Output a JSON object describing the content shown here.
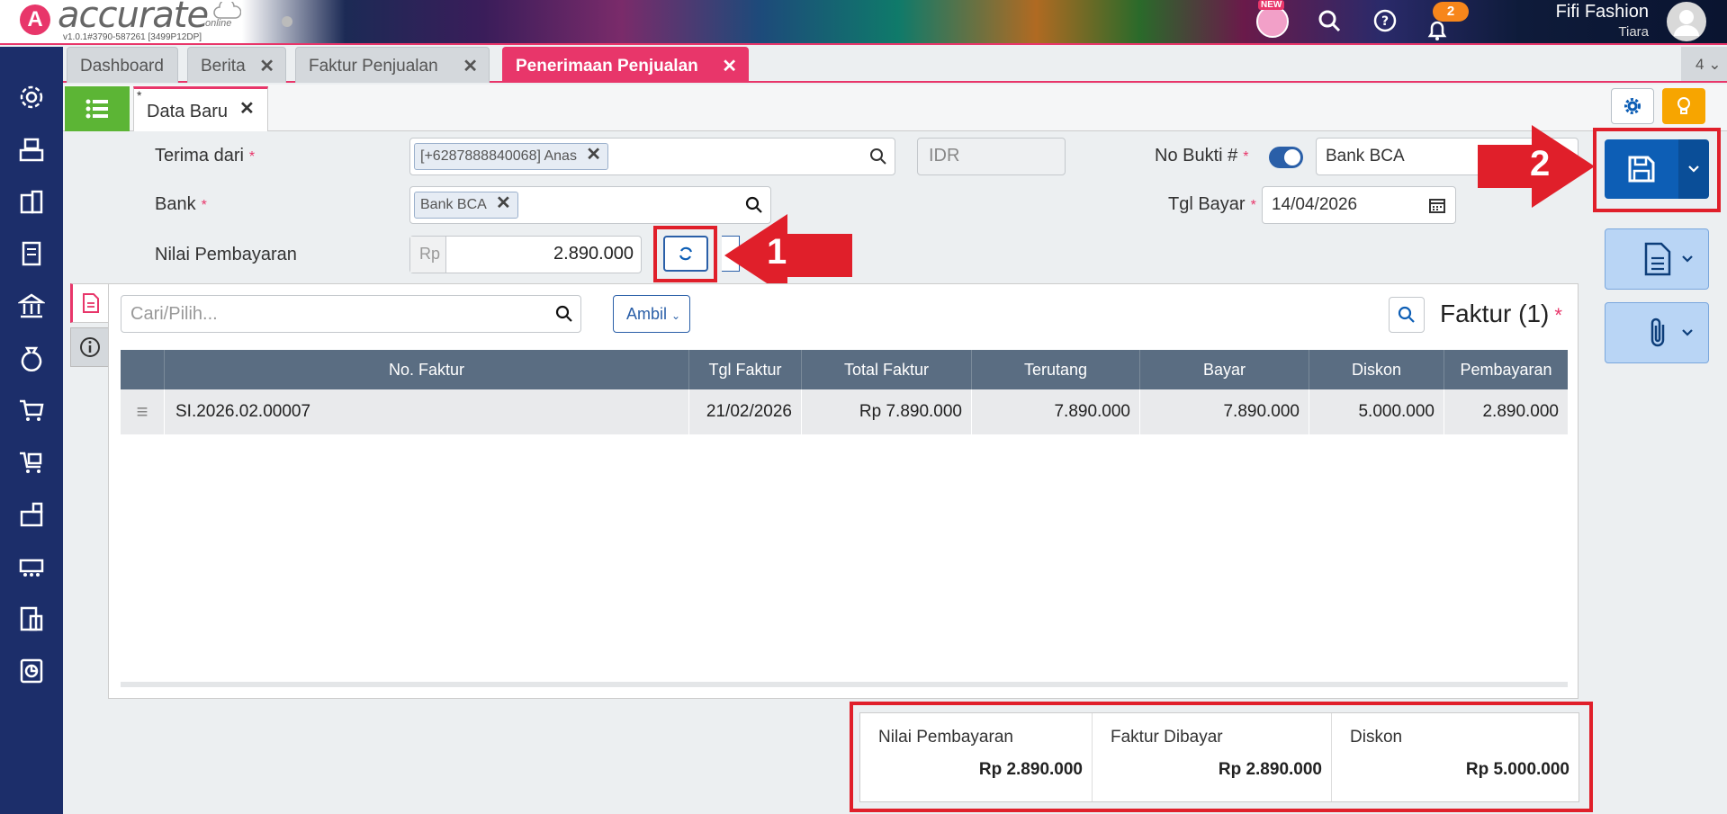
{
  "header": {
    "logo_text": "accurate",
    "logo_sub": "online",
    "version": "v1.0.1#3790-587261 [3499P12DP]",
    "new_badge": "NEW",
    "notif_count": "2",
    "user_name": "Fifi Fashion",
    "user_role": "Tiara"
  },
  "tabs": [
    {
      "label": "Dashboard"
    },
    {
      "label": "Berita"
    },
    {
      "label": "Faktur Penjualan"
    },
    {
      "label": "Penerimaan Penjualan"
    }
  ],
  "tab_count": "4",
  "subtab": {
    "label": "Data Baru",
    "dirty_mark": "*"
  },
  "form": {
    "terima_dari_label": "Terima dari",
    "terima_dari_value": "[+6287888840068] Anas",
    "currency": "IDR",
    "no_bukti_label": "No Bukti #",
    "no_bukti_value": "Bank BCA",
    "bank_label": "Bank",
    "bank_value": "Bank BCA",
    "tgl_bayar_label": "Tgl Bayar",
    "tgl_bayar_value": "14/04/2026",
    "nilai_label": "Nilai Pembayaran",
    "nilai_prefix": "Rp",
    "nilai_value": "2.890.000",
    "required_mark": "*"
  },
  "invoice_panel": {
    "search_placeholder": "Cari/Pilih...",
    "ambil_label": "Ambil",
    "title": "Faktur (1)",
    "columns": [
      "No. Faktur",
      "Tgl Faktur",
      "Total Faktur",
      "Terutang",
      "Bayar",
      "Diskon",
      "Pembayaran"
    ],
    "rows": [
      {
        "no_faktur": "SI.2026.02.00007",
        "tgl_faktur": "21/02/2026",
        "total": "Rp 7.890.000",
        "terutang": "7.890.000",
        "bayar": "7.890.000",
        "diskon": "5.000.000",
        "pembayaran": "2.890.000"
      }
    ]
  },
  "summary": [
    {
      "label": "Nilai Pembayaran",
      "value": "Rp 2.890.000"
    },
    {
      "label": "Faktur Dibayar",
      "value": "Rp 2.890.000"
    },
    {
      "label": "Diskon",
      "value": "Rp 5.000.000"
    }
  ],
  "annotations": {
    "step1": "1",
    "step2": "2"
  },
  "colors": {
    "brand": "#e8366a",
    "primary": "#0d5eb5",
    "sidebar": "#1c2e6a",
    "highlight": "#e01f2a",
    "success": "#5cb535",
    "warning": "#f7a500"
  },
  "sidebar_icons": [
    "settings-icon",
    "cash-register-icon",
    "building-icon",
    "ledger-icon",
    "bank-icon",
    "money-bag-icon",
    "cart-icon",
    "purchase-cart-icon",
    "warehouse-icon",
    "production-icon",
    "tax-icon",
    "report-icon"
  ]
}
